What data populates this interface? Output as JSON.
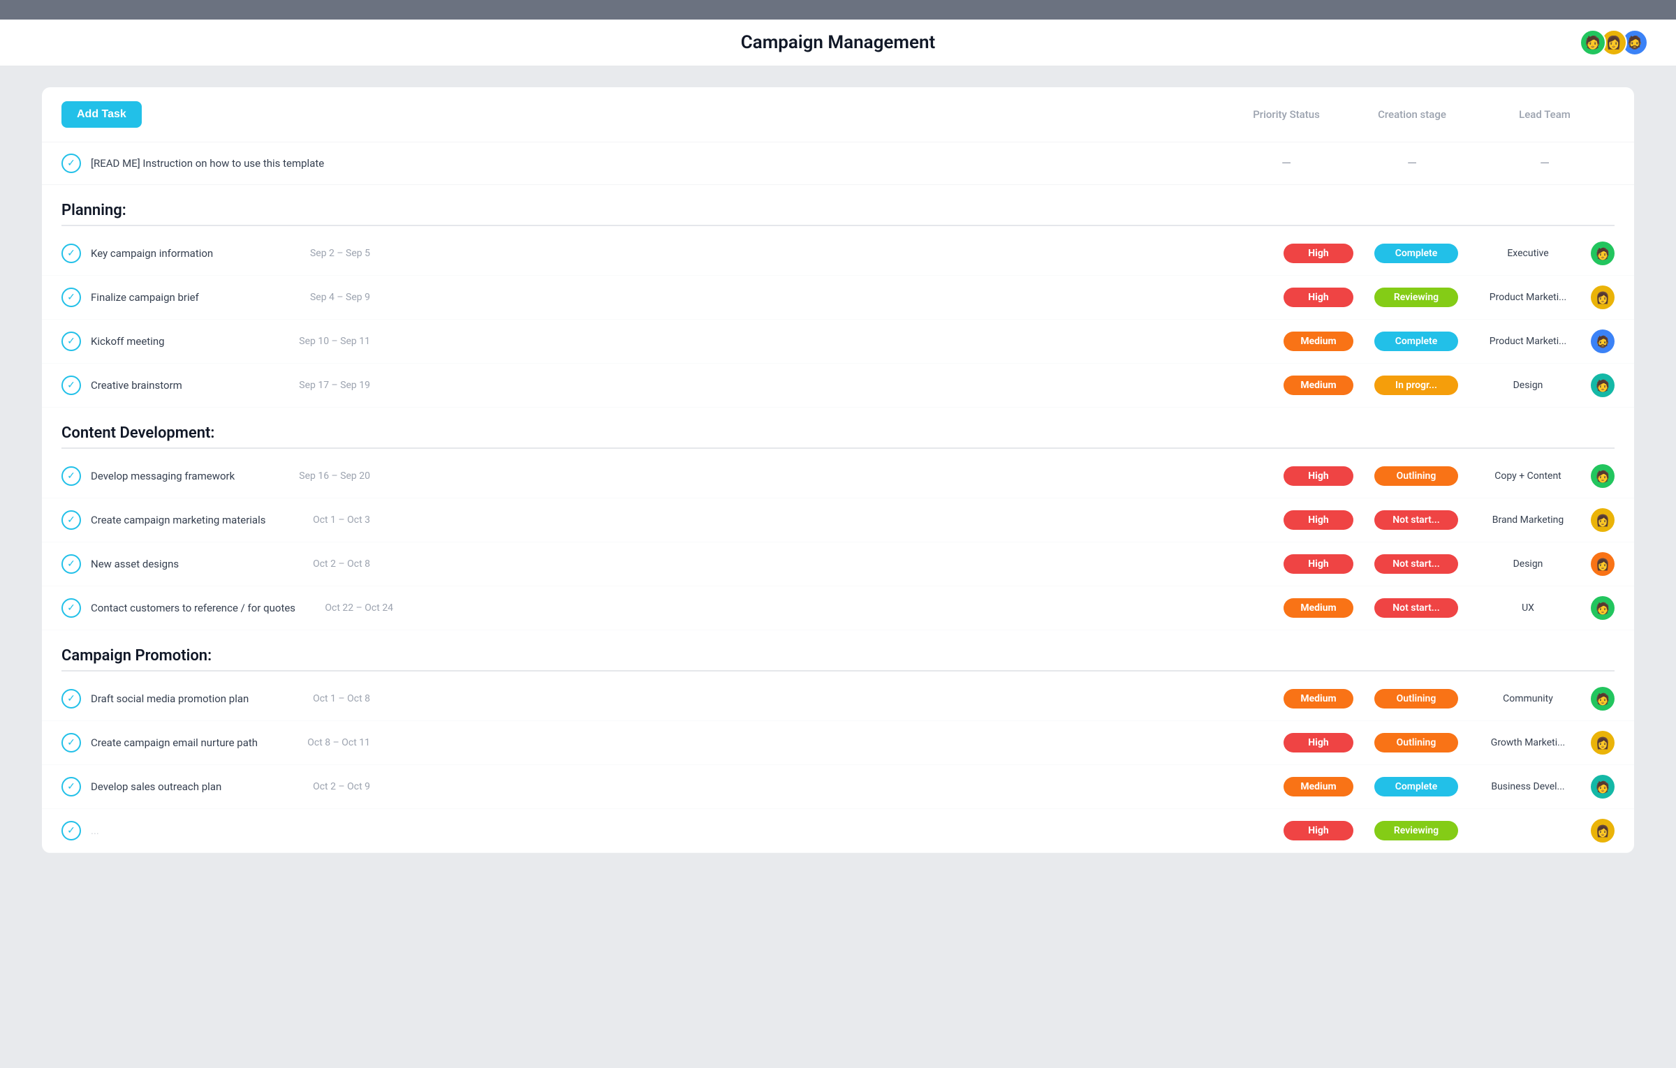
{
  "topBar": {},
  "header": {
    "title": "Campaign Management",
    "avatars": [
      "🧑",
      "👩",
      "🧔"
    ]
  },
  "toolbar": {
    "addTaskLabel": "Add Task",
    "columns": {
      "priority": "Priority Status",
      "creationStage": "Creation stage",
      "leadTeam": "Lead Team"
    }
  },
  "readMeRow": {
    "text": "[READ ME] Instruction on how to use this template"
  },
  "sections": [
    {
      "title": "Planning:",
      "tasks": [
        {
          "name": "Key campaign information",
          "date": "Sep 2 – Sep 5",
          "priority": "High",
          "priorityClass": "priority-high",
          "status": "Complete",
          "statusClass": "status-complete",
          "leadTeam": "Executive",
          "avatarEmoji": "🧑",
          "avatarClass": "avatar-green"
        },
        {
          "name": "Finalize campaign brief",
          "date": "Sep 4 – Sep 9",
          "priority": "High",
          "priorityClass": "priority-high",
          "status": "Reviewing",
          "statusClass": "status-reviewing",
          "leadTeam": "Product Marketi...",
          "avatarEmoji": "👩",
          "avatarClass": "avatar-yellow"
        },
        {
          "name": "Kickoff meeting",
          "date": "Sep 10 – Sep 11",
          "priority": "Medium",
          "priorityClass": "priority-medium",
          "status": "Complete",
          "statusClass": "status-complete",
          "leadTeam": "Product Marketi...",
          "avatarEmoji": "🧔",
          "avatarClass": "avatar-blue"
        },
        {
          "name": "Creative brainstorm",
          "date": "Sep 17 – Sep 19",
          "priority": "Medium",
          "priorityClass": "priority-medium",
          "status": "In progr...",
          "statusClass": "status-inprogress",
          "leadTeam": "Design",
          "avatarEmoji": "🧑",
          "avatarClass": "avatar-teal"
        }
      ]
    },
    {
      "title": "Content Development:",
      "tasks": [
        {
          "name": "Develop messaging framework",
          "date": "Sep 16 – Sep 20",
          "priority": "High",
          "priorityClass": "priority-high",
          "status": "Outlining",
          "statusClass": "status-outlining",
          "leadTeam": "Copy + Content",
          "avatarEmoji": "🧑",
          "avatarClass": "avatar-green"
        },
        {
          "name": "Create campaign marketing materials",
          "date": "Oct 1 – Oct 3",
          "priority": "High",
          "priorityClass": "priority-high",
          "status": "Not start...",
          "statusClass": "status-notstart",
          "leadTeam": "Brand Marketing",
          "avatarEmoji": "👩",
          "avatarClass": "avatar-yellow"
        },
        {
          "name": "New asset designs",
          "date": "Oct 2 – Oct 8",
          "priority": "High",
          "priorityClass": "priority-high",
          "status": "Not start...",
          "statusClass": "status-notstart",
          "leadTeam": "Design",
          "avatarEmoji": "👩",
          "avatarClass": "avatar-orange"
        },
        {
          "name": "Contact customers to reference / for quotes",
          "date": "Oct 22 – Oct 24",
          "priority": "Medium",
          "priorityClass": "priority-medium",
          "status": "Not start...",
          "statusClass": "status-notstart",
          "leadTeam": "UX",
          "avatarEmoji": "🧑",
          "avatarClass": "avatar-green"
        }
      ]
    },
    {
      "title": "Campaign Promotion:",
      "tasks": [
        {
          "name": "Draft social media promotion plan",
          "date": "Oct 1 – Oct 8",
          "priority": "Medium",
          "priorityClass": "priority-medium",
          "status": "Outlining",
          "statusClass": "status-outlining",
          "leadTeam": "Community",
          "avatarEmoji": "🧑",
          "avatarClass": "avatar-green"
        },
        {
          "name": "Create campaign email nurture path",
          "date": "Oct 8 – Oct 11",
          "priority": "High",
          "priorityClass": "priority-high",
          "status": "Outlining",
          "statusClass": "status-outlining",
          "leadTeam": "Growth Marketi...",
          "avatarEmoji": "👩",
          "avatarClass": "avatar-yellow"
        },
        {
          "name": "Develop sales outreach plan",
          "date": "Oct 2 – Oct 9",
          "priority": "Medium",
          "priorityClass": "priority-medium",
          "status": "Complete",
          "statusClass": "status-complete",
          "leadTeam": "Business Devel...",
          "avatarEmoji": "🧑",
          "avatarClass": "avatar-teal"
        },
        {
          "name": "...",
          "date": "",
          "priority": "High",
          "priorityClass": "priority-high",
          "status": "Reviewing",
          "statusClass": "status-reviewing",
          "leadTeam": "",
          "avatarEmoji": "👩",
          "avatarClass": "avatar-yellow"
        }
      ]
    }
  ]
}
